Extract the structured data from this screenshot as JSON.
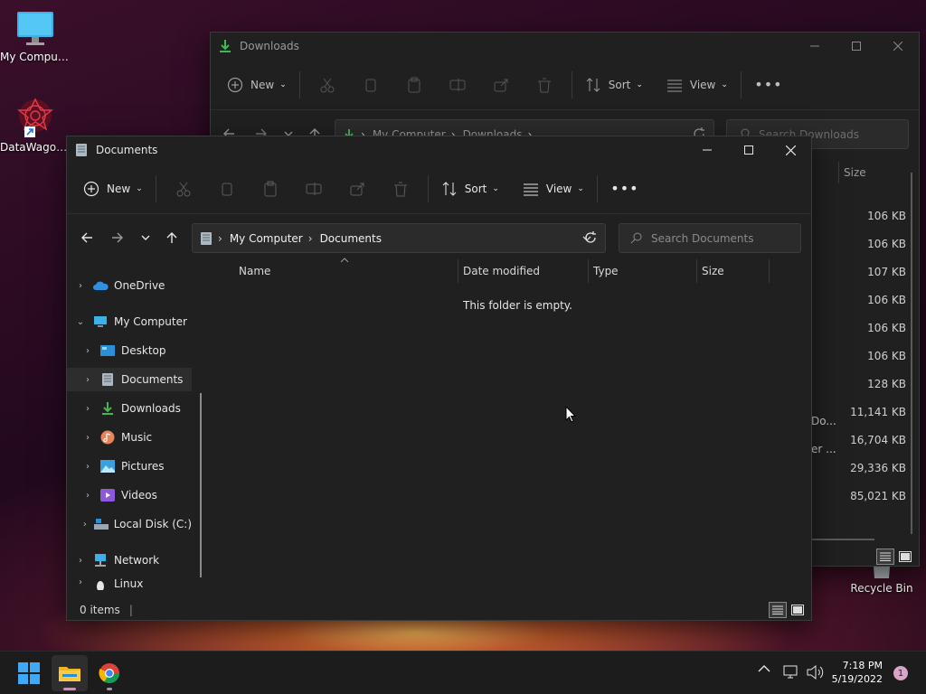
{
  "desktop": {
    "icons": [
      {
        "label": "My Computer"
      },
      {
        "label": "DataWagon..."
      },
      {
        "label": "Recycle Bin"
      }
    ]
  },
  "downloads_window": {
    "title": "Downloads",
    "toolbar": {
      "new_label": "New",
      "sort_label": "Sort",
      "view_label": "View"
    },
    "breadcrumb": [
      "My Computer",
      "Downloads"
    ],
    "search_placeholder": "Search Downloads",
    "size_header": "Size",
    "sizes": [
      "106 KB",
      "106 KB",
      "107 KB",
      "106 KB",
      "106 KB",
      "106 KB",
      "128 KB",
      "11,141 KB",
      "16,704 KB",
      "29,336 KB",
      "85,021 KB"
    ],
    "partial_names": [
      "Do...",
      "er ..."
    ]
  },
  "documents_window": {
    "title": "Documents",
    "toolbar": {
      "new_label": "New",
      "sort_label": "Sort",
      "view_label": "View"
    },
    "breadcrumb": [
      "My Computer",
      "Documents"
    ],
    "search_placeholder": "Search Documents",
    "columns": [
      "Name",
      "Date modified",
      "Type",
      "Size"
    ],
    "empty_message": "This folder is empty.",
    "status": "0 items",
    "nav": {
      "onedrive": "OneDrive",
      "my_computer": "My Computer",
      "desktop": "Desktop",
      "documents": "Documents",
      "downloads": "Downloads",
      "music": "Music",
      "pictures": "Pictures",
      "videos": "Videos",
      "local_disk": "Local Disk (C:)",
      "network": "Network",
      "linux": "Linux"
    }
  },
  "taskbar": {
    "time": "7:18 PM",
    "date": "5/19/2022",
    "notification_count": "1"
  },
  "colors": {
    "accent_blue": "#4cc2ff",
    "download_green": "#3fb950",
    "window_bg": "#202020",
    "taskbar_bg": "#1c1c1c"
  }
}
